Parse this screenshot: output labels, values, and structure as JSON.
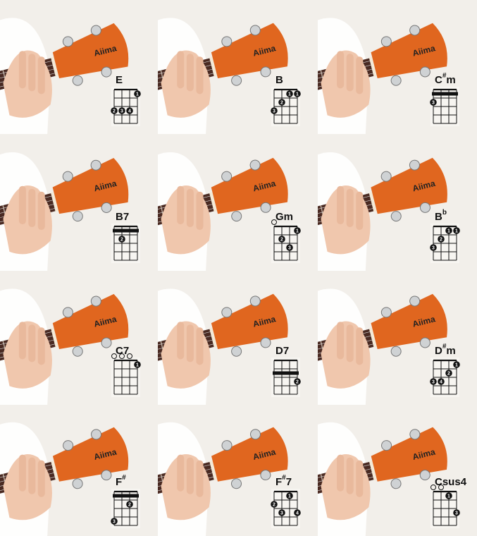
{
  "brand": "Aiima",
  "colors": {
    "background": "#f2efea",
    "headstock": "#e0661f",
    "fretboard": "#4a2a22",
    "skin": "#f0c7ad",
    "sleeve": "#ffffff",
    "diagram_line": "#111111",
    "dot": "#111111",
    "dot_text": "#ffffff"
  },
  "chords": [
    {
      "root": "E",
      "accidental": "",
      "quality": "",
      "open": [],
      "barre": null,
      "dots": [
        {
          "s": 3,
          "f": 1,
          "n": "1"
        },
        {
          "s": 0,
          "f": 3,
          "n": "2"
        },
        {
          "s": 1,
          "f": 3,
          "n": "3"
        },
        {
          "s": 2,
          "f": 3,
          "n": "4"
        }
      ]
    },
    {
      "root": "B",
      "accidental": "",
      "quality": "",
      "open": [],
      "barre": null,
      "dots": [
        {
          "s": 2,
          "f": 1,
          "n": "1"
        },
        {
          "s": 3,
          "f": 1,
          "n": "1"
        },
        {
          "s": 1,
          "f": 2,
          "n": "2"
        },
        {
          "s": 0,
          "f": 3,
          "n": "3"
        }
      ]
    },
    {
      "root": "C",
      "accidental": "#",
      "quality": "m",
      "open": [],
      "barre": {
        "f": 1
      },
      "dots": [
        {
          "s": 0,
          "f": 2,
          "n": "3"
        }
      ]
    },
    {
      "root": "B",
      "accidental": "",
      "quality": "7",
      "open": [],
      "barre": {
        "f": 1
      },
      "dots": [
        {
          "s": 1,
          "f": 2,
          "n": "2"
        }
      ]
    },
    {
      "root": "G",
      "accidental": "",
      "quality": "m",
      "open": [
        0
      ],
      "barre": null,
      "dots": [
        {
          "s": 3,
          "f": 1,
          "n": "1"
        },
        {
          "s": 1,
          "f": 2,
          "n": "2"
        },
        {
          "s": 2,
          "f": 3,
          "n": "3"
        }
      ]
    },
    {
      "root": "B",
      "accidental": "b",
      "quality": "",
      "open": [],
      "barre": null,
      "dots": [
        {
          "s": 2,
          "f": 1,
          "n": "1"
        },
        {
          "s": 3,
          "f": 1,
          "n": "1"
        },
        {
          "s": 1,
          "f": 2,
          "n": "2"
        },
        {
          "s": 0,
          "f": 3,
          "n": "3"
        }
      ]
    },
    {
      "root": "C",
      "accidental": "",
      "quality": "7",
      "open": [
        0,
        1,
        2
      ],
      "barre": null,
      "dots": [
        {
          "s": 3,
          "f": 1,
          "n": "1"
        }
      ]
    },
    {
      "root": "D",
      "accidental": "",
      "quality": "7",
      "open": [],
      "barre": {
        "f": 2
      },
      "dots": [
        {
          "s": 3,
          "f": 3,
          "n": "2"
        }
      ]
    },
    {
      "root": "D",
      "accidental": "#",
      "quality": "m",
      "open": [],
      "barre": null,
      "dots": [
        {
          "s": 3,
          "f": 1,
          "n": "1"
        },
        {
          "s": 2,
          "f": 2,
          "n": "2"
        },
        {
          "s": 0,
          "f": 3,
          "n": "3"
        },
        {
          "s": 1,
          "f": 3,
          "n": "4"
        }
      ]
    },
    {
      "root": "F",
      "accidental": "#",
      "quality": "",
      "open": [],
      "barre": {
        "f": 1
      },
      "dots": [
        {
          "s": 2,
          "f": 2,
          "n": "2"
        },
        {
          "s": 0,
          "f": 4,
          "n": "3"
        }
      ]
    },
    {
      "root": "F",
      "accidental": "#",
      "quality": "7",
      "open": [],
      "barre": null,
      "dots": [
        {
          "s": 2,
          "f": 1,
          "n": "1"
        },
        {
          "s": 0,
          "f": 2,
          "n": "2"
        },
        {
          "s": 1,
          "f": 3,
          "n": "3"
        },
        {
          "s": 3,
          "f": 3,
          "n": "4"
        }
      ]
    },
    {
      "root": "C",
      "accidental": "",
      "quality": "sus4",
      "open": [
        0,
        1
      ],
      "barre": null,
      "dots": [
        {
          "s": 2,
          "f": 1,
          "n": "1"
        },
        {
          "s": 3,
          "f": 3,
          "n": "3"
        }
      ]
    }
  ]
}
